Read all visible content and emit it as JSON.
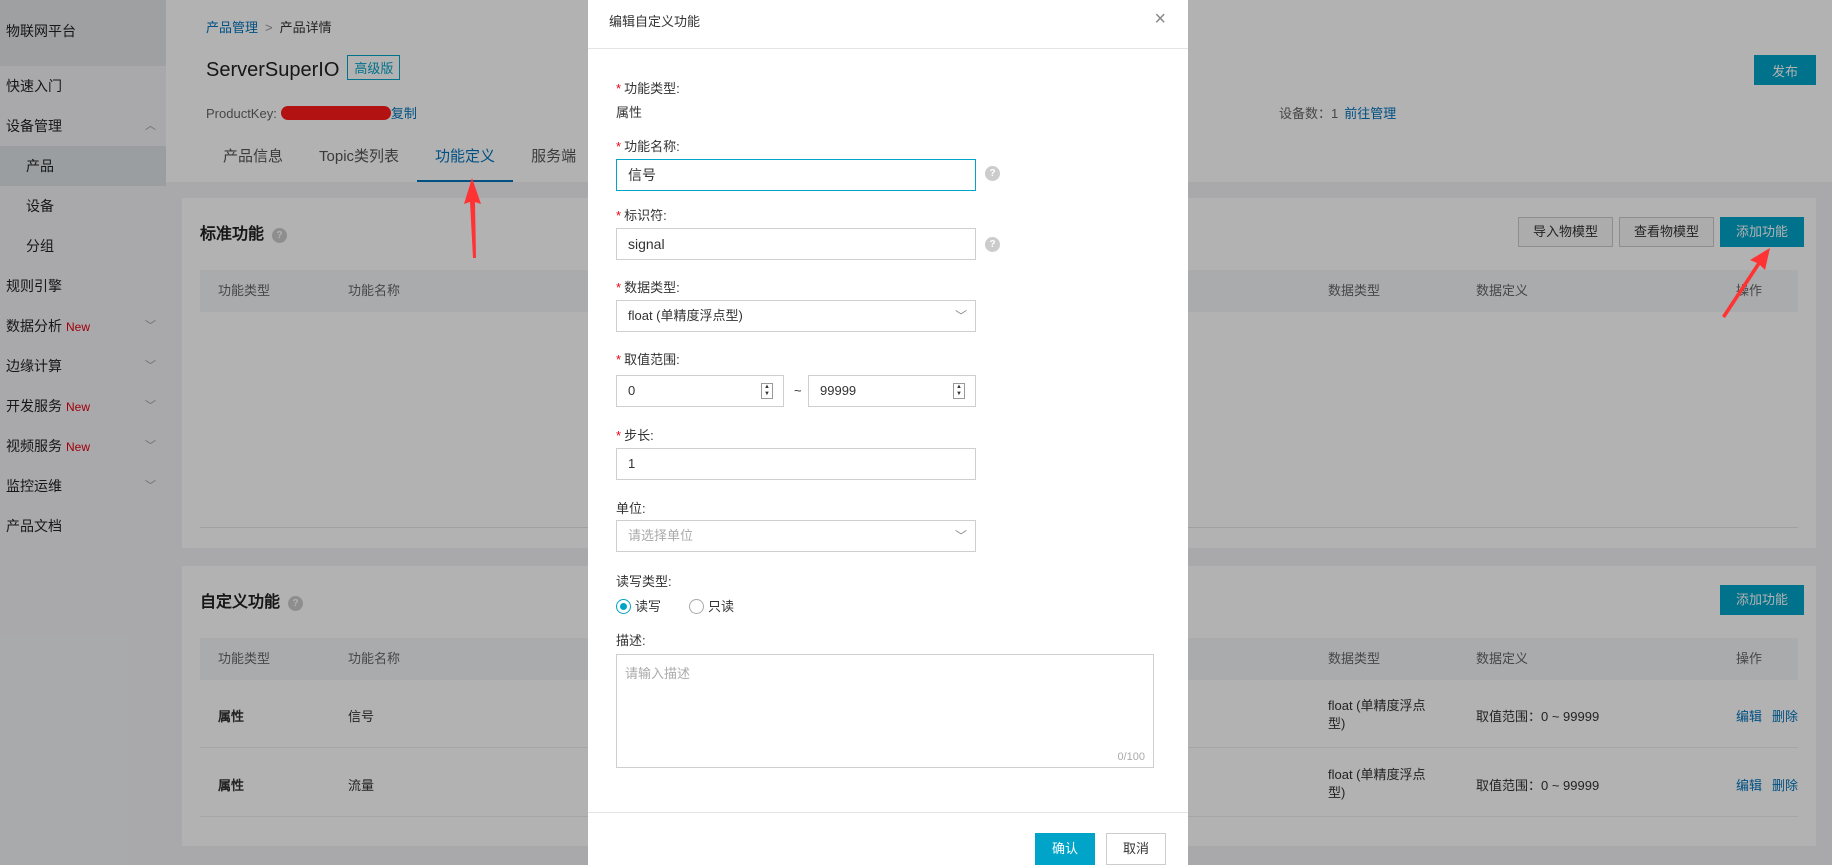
{
  "sidebar": {
    "title": "物联网平台",
    "items": [
      {
        "label": "快速入门",
        "new": "",
        "chev": false
      },
      {
        "label": "设备管理",
        "new": "",
        "chev": "up"
      },
      {
        "label": "产品",
        "new": "",
        "sub": true,
        "active": true
      },
      {
        "label": "设备",
        "new": "",
        "sub": true
      },
      {
        "label": "分组",
        "new": "",
        "sub": true
      },
      {
        "label": "规则引擎",
        "new": "",
        "chev": false
      },
      {
        "label": "数据分析",
        "new": "New",
        "chev": "down"
      },
      {
        "label": "边缘计算",
        "new": "",
        "chev": "down"
      },
      {
        "label": "开发服务",
        "new": "New",
        "chev": "down"
      },
      {
        "label": "视频服务",
        "new": "New",
        "chev": "down"
      },
      {
        "label": "监控运维",
        "new": "",
        "chev": "down"
      },
      {
        "label": "产品文档",
        "new": "",
        "chev": false
      }
    ]
  },
  "header": {
    "breadcrumb_parent": "产品管理",
    "breadcrumb_sep": ">",
    "breadcrumb_current": "产品详情",
    "product_name": "ServerSuperIO",
    "edition_badge": "高级版",
    "product_key_label": "ProductKey:",
    "copy_label": "复制",
    "device_count_label": "设备数：",
    "device_count": "1",
    "manage_link": "前往管理",
    "publish_label": "发布",
    "tabs": [
      "产品信息",
      "Topic类列表",
      "功能定义",
      "服务端"
    ]
  },
  "standard_card": {
    "title": "标准功能",
    "buttons": [
      "导入物模型",
      "查看物模型",
      "添加功能"
    ],
    "columns": [
      "功能类型",
      "功能名称",
      "数据类型",
      "数据定义",
      "操作"
    ]
  },
  "custom_card": {
    "title": "自定义功能",
    "add_label": "添加功能",
    "columns": [
      "功能类型",
      "功能名称",
      "数据类型",
      "数据定义",
      "操作"
    ],
    "rows": [
      {
        "type": "属性",
        "name": "信号",
        "data_type_1": "float (单精度浮点",
        "data_type_2": "型)",
        "def": "取值范围：0 ~ 99999",
        "edit": "编辑",
        "delete": "删除"
      },
      {
        "type": "属性",
        "name": "流量",
        "data_type_1": "float (单精度浮点",
        "data_type_2": "型)",
        "def": "取值范围：0 ~ 99999",
        "edit": "编辑",
        "delete": "删除"
      }
    ]
  },
  "modal": {
    "title": "编辑自定义功能",
    "close_glyph": "×",
    "fields": {
      "type_label": "功能类型:",
      "type_value": "属性",
      "name_label": "功能名称:",
      "name_value": "信号",
      "identifier_label": "标识符:",
      "identifier_value": "signal",
      "datatype_label": "数据类型:",
      "datatype_value": "float (单精度浮点型)",
      "range_label": "取值范围:",
      "range_min": "0",
      "range_tilde": "~",
      "range_max": "99999",
      "step_label": "步长:",
      "step_value": "1",
      "unit_label": "单位:",
      "unit_placeholder": "请选择单位",
      "rw_label": "读写类型:",
      "rw_options": [
        "读写",
        "只读"
      ],
      "rw_selected": "读写",
      "desc_label": "描述:",
      "desc_placeholder": "请输入描述",
      "desc_counter": "0/100"
    },
    "required_mark": "*",
    "help_glyph": "?",
    "confirm_label": "确认",
    "cancel_label": "取消"
  },
  "colors": {
    "accent": "#00a4c8",
    "link": "#0073bd",
    "required": "#e60012",
    "annotation_arrow": "#ff3333"
  }
}
